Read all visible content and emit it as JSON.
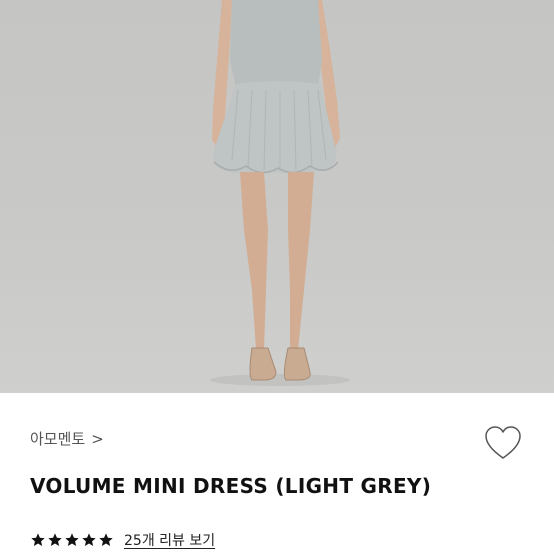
{
  "product": {
    "brand": "아모멘토",
    "brand_chevron": ">",
    "name": "VOLUME MINI DRESS (LIGHT GREY)",
    "rating": 5,
    "rating_max": 5,
    "reviews_label": "25개 리뷰 보기"
  },
  "icons": {
    "wishlist": "heart-outline-icon",
    "star": "star-filled-icon",
    "brand_chevron": "chevron-right-icon"
  },
  "colors": {
    "background_photo": "#c8c8c6",
    "dress": "#b9bfbe",
    "star": "#111111",
    "text": "#111111"
  }
}
